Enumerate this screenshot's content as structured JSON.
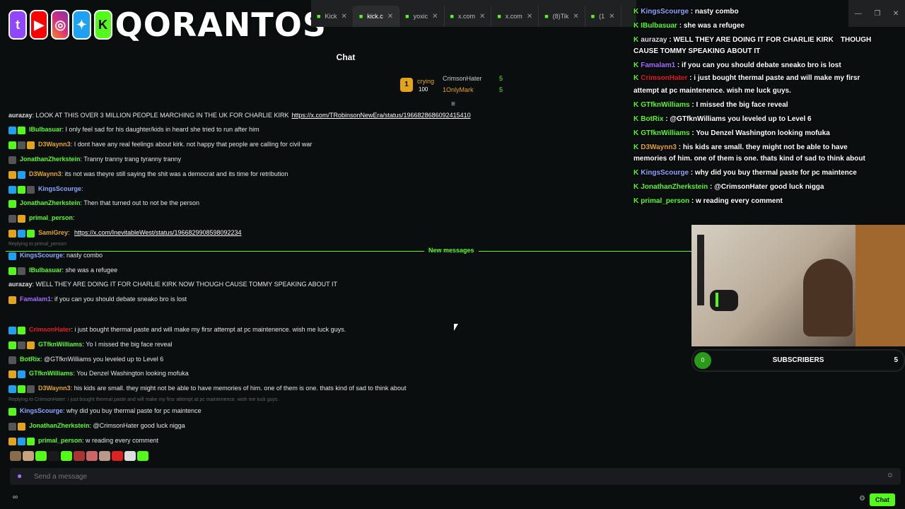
{
  "browser": {
    "tabs": [
      {
        "label": "Kick",
        "active": false
      },
      {
        "label": "kick.c",
        "active": true
      },
      {
        "label": "yoxic",
        "active": false
      },
      {
        "label": "x.com",
        "active": false
      },
      {
        "label": "x.com",
        "active": false
      },
      {
        "label": "(8)Tik",
        "active": false
      },
      {
        "label": "(1",
        "active": false
      }
    ]
  },
  "branding": {
    "text": "QORANTOS"
  },
  "chat": {
    "title": "Chat",
    "leaderboard": {
      "top_name": "crying",
      "top_value": "100",
      "rows": [
        {
          "name": "CrimsonHater",
          "count": "5"
        },
        {
          "name": "1OnlyMark",
          "count": "5"
        }
      ]
    },
    "messages": [
      {
        "user": "aurazay",
        "color": "#dddddd",
        "text": "LOOK AT THIS OVER 3 MILLION PEOPLE MARCHING IN THE UK FOR CHARLIE KIRK",
        "link": "https://x.com/TRobinsonNewEra/status/1966828686092415410"
      },
      {
        "user": "IBulbasuar",
        "color": "#53fc18",
        "text": "I only feel sad for his daughter/kids in heard she tried to run after him"
      },
      {
        "user": "D3Waynn3",
        "color": "#e3a517",
        "text": "I dont have any real feelings about kirk. not happy that people are calling for civil war"
      },
      {
        "user": "JonathanZherkstein",
        "color": "#53fc18",
        "text": "Tranny tranny trang tyranny tranny"
      },
      {
        "user": "D3Waynn3",
        "color": "#e3a517",
        "text": "its not was theyre still saying the shit was a democrat and its time for retribution"
      },
      {
        "user": "KingsScourge",
        "color": "#8aa8ff",
        "text": ""
      },
      {
        "user": "JonathanZherkstein",
        "color": "#53fc18",
        "text": "Then that turned out to not be the person"
      },
      {
        "user": "primal_person",
        "color": "#53fc18",
        "text": ""
      },
      {
        "user": "SamiGrey",
        "color": "#e3a517",
        "text": "",
        "link": "https://x.com/InevitableWest/status/1966829908598092234"
      },
      {
        "user": "KingsScourge",
        "color": "#8aa8ff",
        "text": "nasty combo",
        "reply": "Replying to primal_person:"
      },
      {
        "user": "IBulbasuar",
        "color": "#53fc18",
        "text": "she was a refugee"
      },
      {
        "user": "aurazay",
        "color": "#dddddd",
        "text": "WELL THEY ARE DOING IT FOR CHARLIE KIRK NOW THOUGH CAUSE TOMMY SPEAKING ABOUT IT"
      },
      {
        "user": "Famalam1",
        "color": "#a36bff",
        "text": "if you can you should debate sneako bro is lost"
      },
      {
        "user": "CrimsonHater",
        "color": "#e01c1c",
        "text": "i just bought thermal paste and will make my firsr attempt at pc maintenence. wish me luck guys."
      },
      {
        "user": "GTfknWilliams",
        "color": "#53fc18",
        "text": "Yo I missed the big face reveal"
      },
      {
        "user": "BotRix",
        "color": "#53fc18",
        "text": "@GTfknWilliams you leveled up to Level 6"
      },
      {
        "user": "GTfknWilliams",
        "color": "#53fc18",
        "text": "You Denzel Washington looking mofuka"
      },
      {
        "user": "D3Waynn3",
        "color": "#e3a517",
        "text": "his kids are small. they might not be able to have memories of him. one of them is one. thats kind of sad to think about"
      },
      {
        "user": "KingsScourge",
        "color": "#8aa8ff",
        "text": "why did you buy thermal paste for pc maintence",
        "reply": "Replying to CrimsonHater: i just bought thermal paste and will make my firsr attempt at pc maintenence. wish me luck guys."
      },
      {
        "user": "JonathanZherkstein",
        "color": "#53fc18",
        "text": "@CrimsonHater good luck nigga"
      },
      {
        "user": "primal_person",
        "color": "#53fc18",
        "text": "w reading every comment"
      }
    ],
    "new_messages_label": "New messages",
    "input_placeholder": "Send a message",
    "chat_button": "Chat"
  },
  "overlay_messages": [
    {
      "user": "KingsScourge",
      "text": "nasty combo",
      "color": "#8aa8ff"
    },
    {
      "user": "IBulbasuar",
      "text": "she was a refugee",
      "color": "#53fc18"
    },
    {
      "user": "aurazay",
      "text": "WELL THEY ARE DOING IT FOR CHARLIE KIRK",
      "text2": "THOUGH",
      "extra": "CAUSE TOMMY SPEAKING ABOUT IT",
      "color": "#dddddd"
    },
    {
      "user": "Famalam1",
      "text": "if you can you should debate sneako bro is lost",
      "color": "#a36bff"
    },
    {
      "user": "CrimsonHater",
      "text": "i just bought thermal paste and will make my firsr",
      "extra": "attempt at pc maintenence. wish me luck guys.",
      "color": "#e01c1c"
    },
    {
      "user": "GTfknWilliams",
      "text": "I missed the big face reveal",
      "color": "#53fc18"
    },
    {
      "user": "BotRix",
      "text": "@GTfknWilliams you leveled up to Level 6",
      "color": "#53fc18"
    },
    {
      "user": "GTfknWilliams",
      "text": "You Denzel Washington looking mofuka",
      "color": "#53fc18"
    },
    {
      "user": "D3Waynn3",
      "text": "his kids are small. they might not be able to have",
      "extra": "memories of him. one of them is one. thats kind of sad to think about",
      "color": "#e3a517"
    },
    {
      "user": "KingsScourge",
      "text": "why did you buy thermal paste for pc maintence",
      "color": "#8aa8ff"
    },
    {
      "user": "JonathanZherkstein",
      "text": "@CrimsonHater good luck nigga",
      "color": "#53fc18"
    },
    {
      "user": "primal_person",
      "text": "w reading every comment",
      "color": "#53fc18"
    }
  ],
  "subs": {
    "current": "0",
    "label": "SUBSCRIBERS",
    "goal": "5"
  }
}
